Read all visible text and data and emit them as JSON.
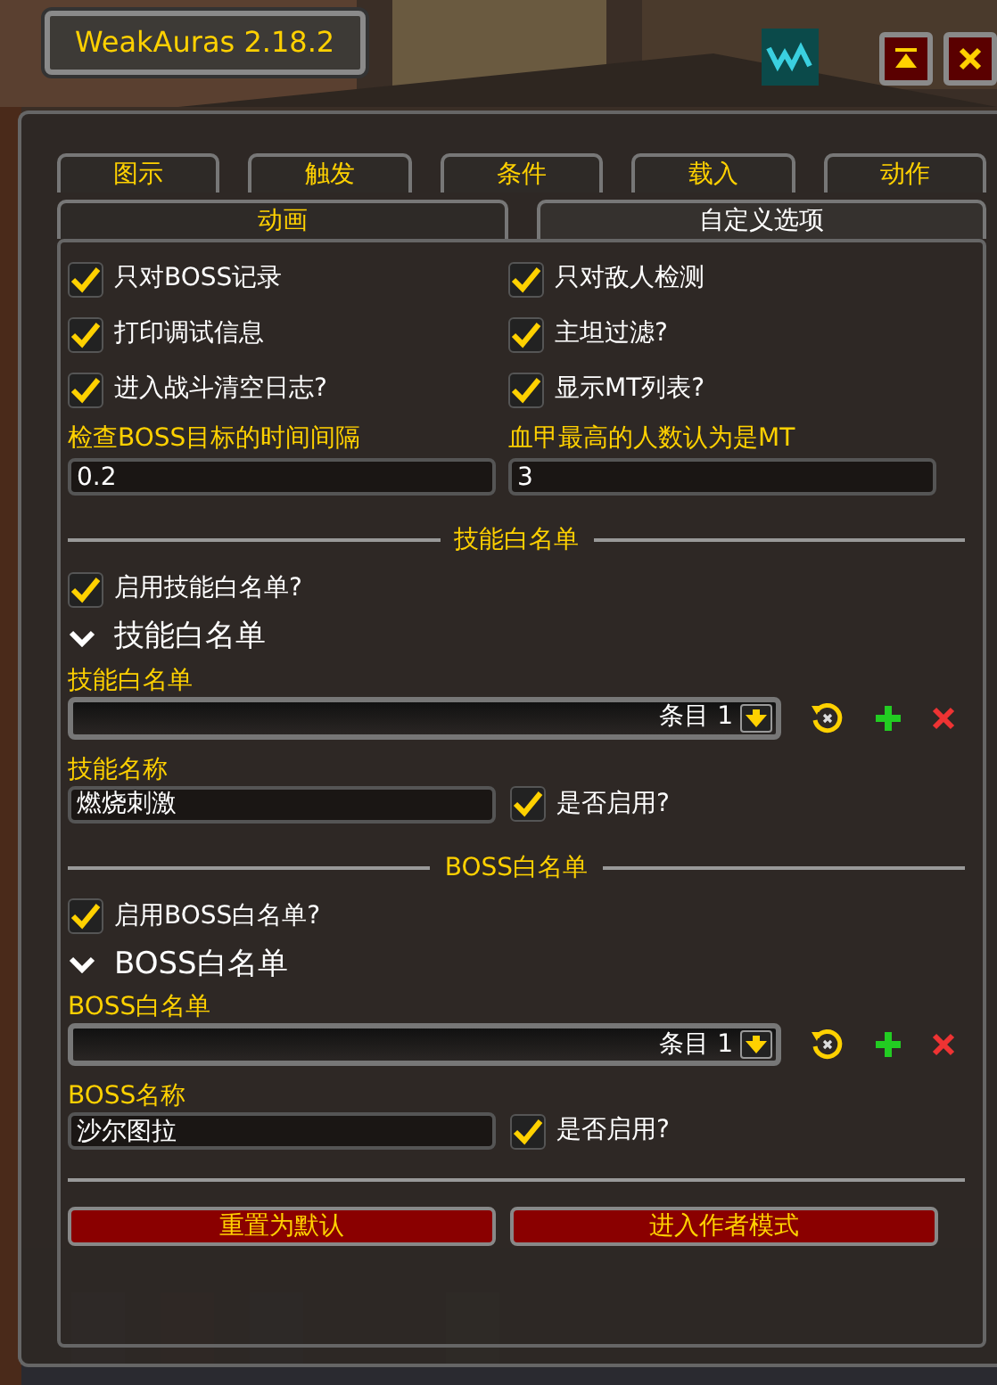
{
  "window": {
    "title": "WeakAuras 2.18.2"
  },
  "tabs_row_1": [
    {
      "label": "图示",
      "selected": false
    },
    {
      "label": "触发",
      "selected": false
    },
    {
      "label": "条件",
      "selected": false
    },
    {
      "label": "载入",
      "selected": false
    },
    {
      "label": "动作",
      "selected": false
    }
  ],
  "tabs_row_2": [
    {
      "label": "动画",
      "selected": false
    },
    {
      "label": "自定义选项",
      "selected": true
    }
  ],
  "options": [
    {
      "label": "只对BOSS记录",
      "checked": true
    },
    {
      "label": "只对敌人检测",
      "checked": true
    },
    {
      "label": "打印调试信息",
      "checked": true
    },
    {
      "label": "主坦过滤?",
      "checked": true
    },
    {
      "label": "进入战斗清空日志?",
      "checked": true
    },
    {
      "label": "显示MT列表?",
      "checked": true
    }
  ],
  "fields": [
    {
      "label": "检查BOSS目标的时间间隔",
      "value": "0.2"
    },
    {
      "label": "血甲最高的人数认为是MT",
      "value": "3"
    }
  ],
  "sections": [
    {
      "heading": "技能白名单",
      "enable": {
        "label": "启用技能白名单?",
        "checked": true
      },
      "group": {
        "label": "技能白名单",
        "expanded": true
      },
      "list_label": "技能白名单",
      "dropdown_value": "条目 1",
      "name_label": "技能名称",
      "name_value": "燃烧刺激",
      "enabled": {
        "label": "是否启用?",
        "checked": true
      }
    },
    {
      "heading": "BOSS白名单",
      "enable": {
        "label": "启用BOSS白名单?",
        "checked": true
      },
      "group": {
        "label": "BOSS白名单",
        "expanded": true
      },
      "list_label": "BOSS白名单",
      "dropdown_value": "条目 1",
      "name_label": "BOSS名称",
      "name_value": "沙尔图拉",
      "enabled": {
        "label": "是否启用?",
        "checked": true
      }
    }
  ],
  "buttons": [
    "重置为默认",
    "进入作者模式"
  ]
}
